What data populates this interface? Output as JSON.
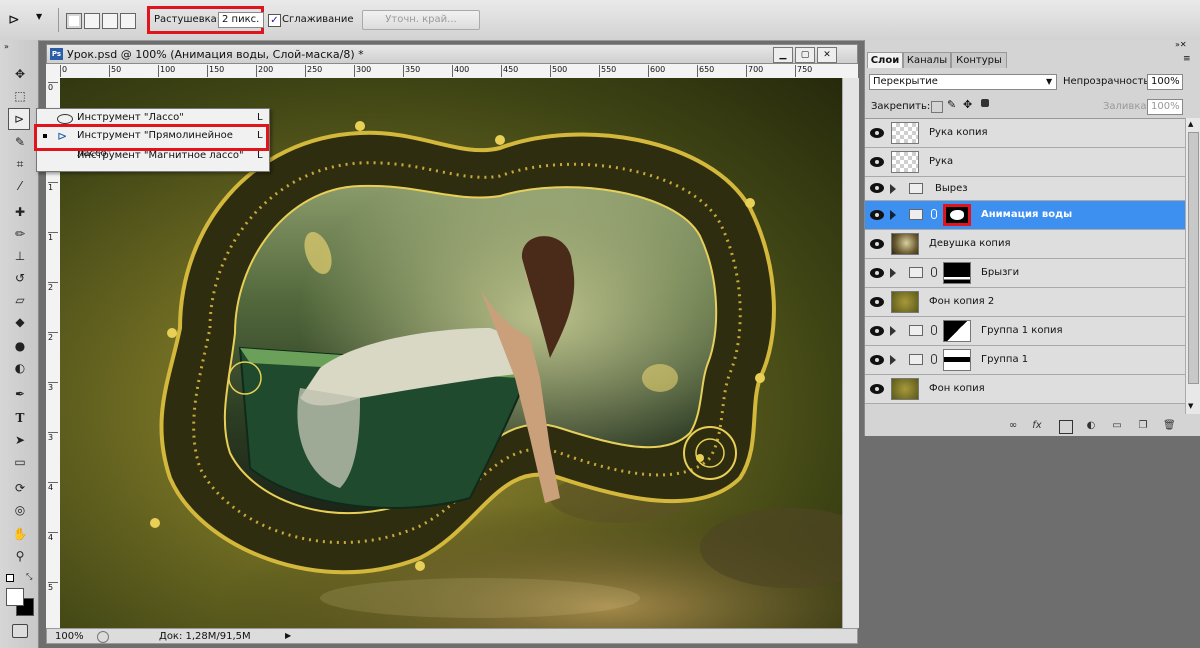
{
  "options_bar": {
    "feather_label": "Растушевка:",
    "feather_value": "2 пикс.",
    "antialias_label": "Сглаживание",
    "refine_edge_button": "Уточн. край..."
  },
  "document": {
    "title": "Урок.psd @ 100% (Анимация воды, Слой-маска/8) *",
    "ps_badge": "Ps",
    "ruler_ticks": [
      "0",
      "50",
      "100",
      "150",
      "200",
      "250",
      "300",
      "350",
      "400",
      "450",
      "500",
      "550",
      "600",
      "650",
      "700",
      "750"
    ],
    "ruler_v_ticks": [
      "0",
      "5",
      "1",
      "1",
      "2",
      "2",
      "3",
      "3",
      "4",
      "4",
      "5"
    ],
    "zoom": "100%",
    "doc_size": "Док: 1,28M/91,5M"
  },
  "flyout": {
    "items": [
      {
        "label": "Инструмент \"Лассо\"",
        "key": "L"
      },
      {
        "label": "Инструмент \"Прямолинейное лассо\"",
        "key": "L"
      },
      {
        "label": "Инструмент \"Магнитное лассо\"",
        "key": "L"
      }
    ]
  },
  "layers_panel": {
    "tabs": [
      "Слои",
      "Каналы",
      "Контуры"
    ],
    "blend_mode": "Перекрытие",
    "opacity_label": "Непрозрачность:",
    "opacity_value": "100%",
    "lock_label": "Закрепить:",
    "fill_label": "Заливка:",
    "fill_value": "100%",
    "layers": [
      {
        "name": "Рука копия",
        "type": "layer",
        "thumb": "checker"
      },
      {
        "name": "Рука",
        "type": "layer",
        "thumb": "checker"
      },
      {
        "name": "Вырез",
        "type": "group"
      },
      {
        "name": "Анимация воды",
        "type": "group-mask",
        "selected": true
      },
      {
        "name": "Девушка копия",
        "type": "layer",
        "thumb": "photo"
      },
      {
        "name": "Брызги",
        "type": "group-mask"
      },
      {
        "name": "Фон копия 2",
        "type": "layer",
        "thumb": "olive"
      },
      {
        "name": "Группа 1 копия",
        "type": "group-mask"
      },
      {
        "name": "Группа 1",
        "type": "group-mask"
      },
      {
        "name": "Фон копия",
        "type": "layer",
        "thumb": "olive"
      }
    ]
  },
  "colors": {
    "highlight": "#e0141c",
    "selected_layer": "#3d8ff0"
  }
}
